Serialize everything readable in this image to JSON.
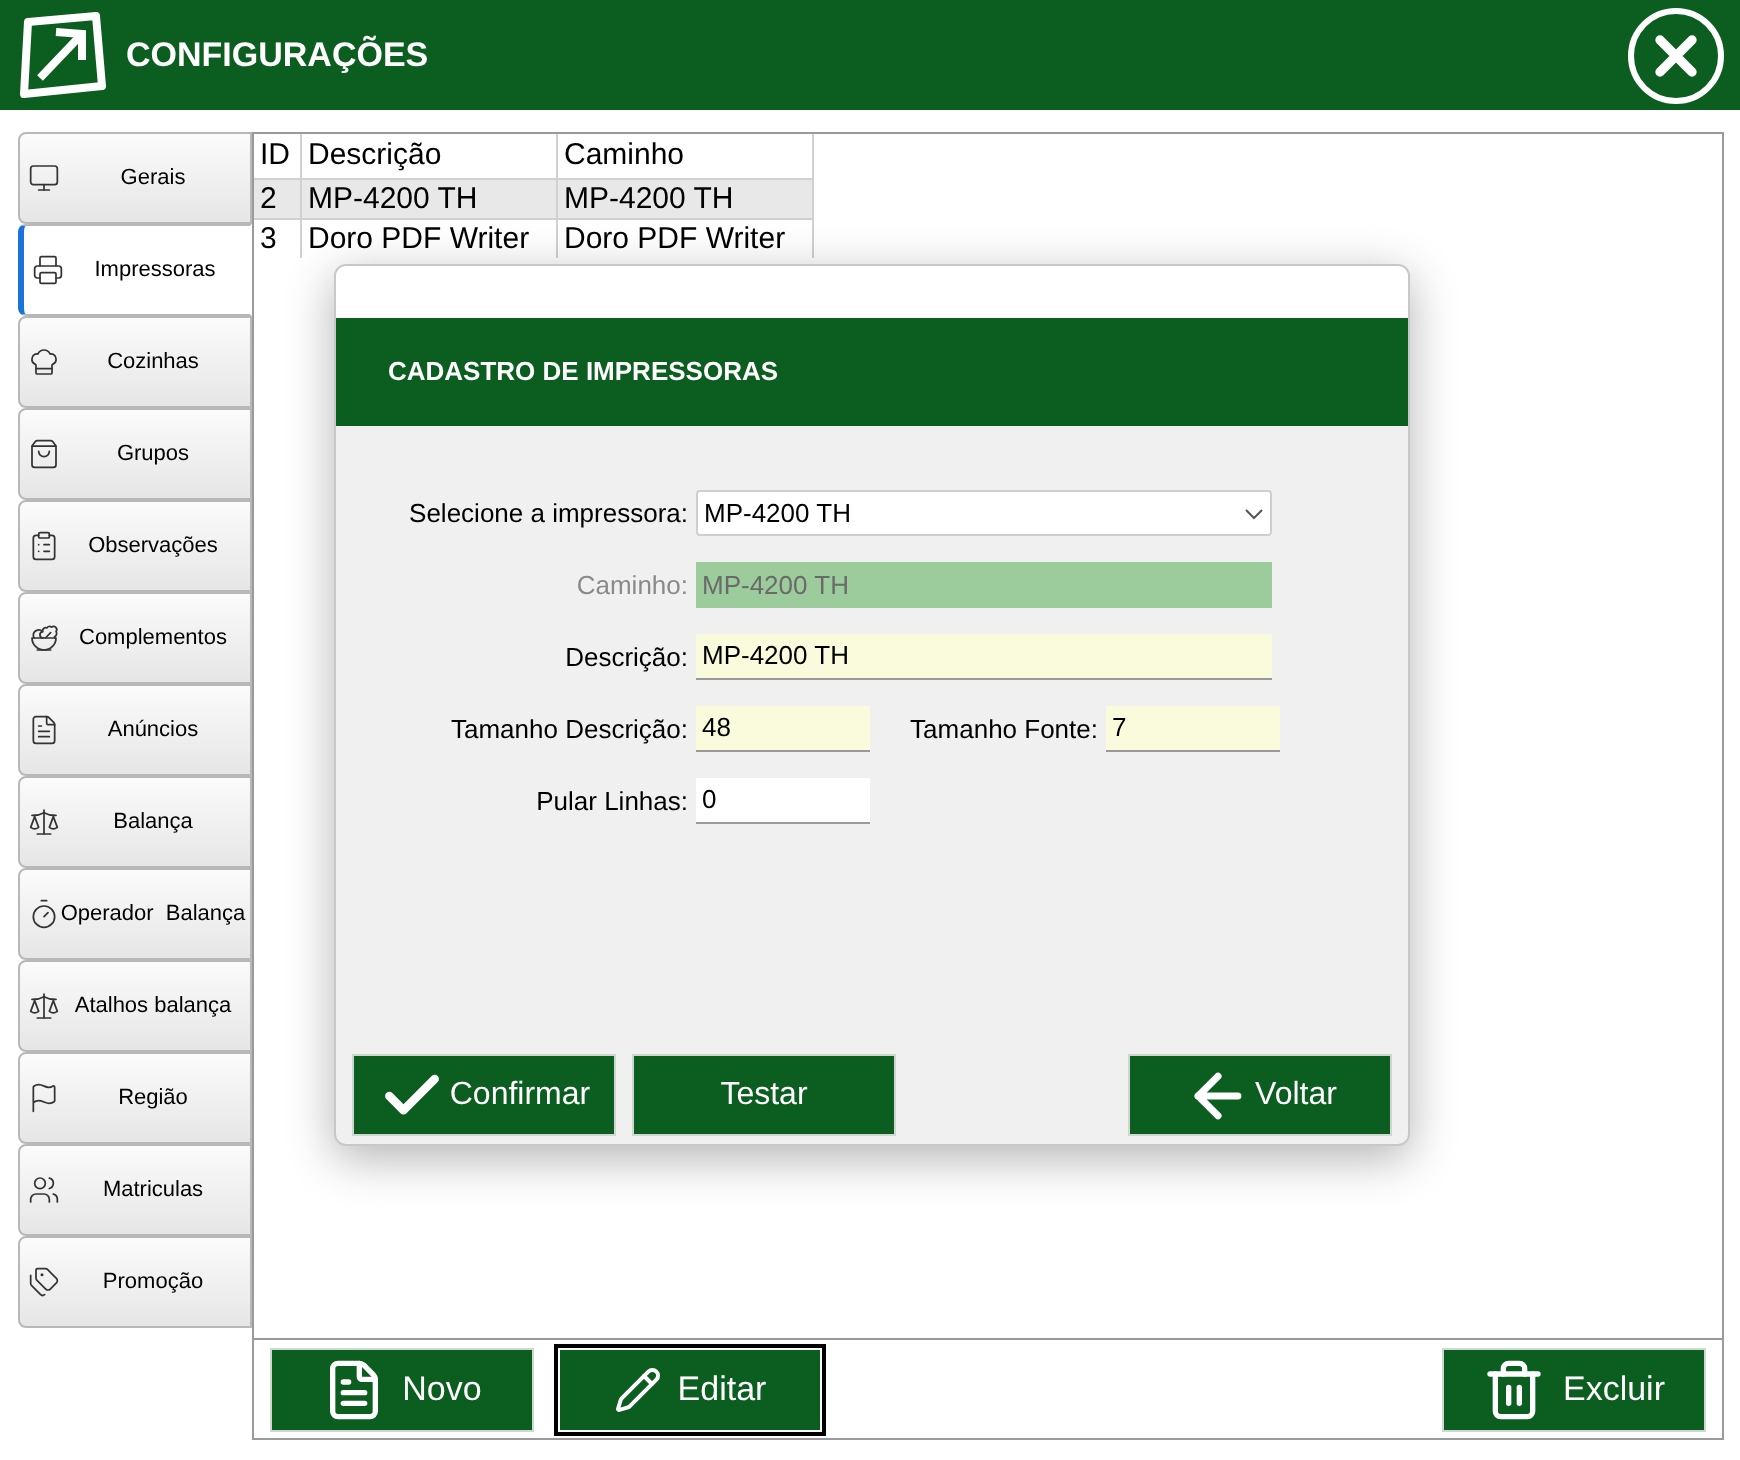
{
  "window": {
    "title": "CONFIGURAÇÕES"
  },
  "sidebar": {
    "items": [
      {
        "label": "Gerais",
        "selected": false
      },
      {
        "label": "Impressoras",
        "selected": true
      },
      {
        "label": "Cozinhas",
        "selected": false
      },
      {
        "label": "Grupos",
        "selected": false
      },
      {
        "label": "Observações",
        "selected": false
      },
      {
        "label": "Complementos",
        "selected": false
      },
      {
        "label": "Anúncios",
        "selected": false
      },
      {
        "label": "Balança",
        "selected": false
      },
      {
        "label": "Operador  Balança",
        "selected": false
      },
      {
        "label": "Atalhos balança",
        "selected": false
      },
      {
        "label": "Região",
        "selected": false
      },
      {
        "label": "Matriculas",
        "selected": false
      },
      {
        "label": "Promoção",
        "selected": false
      }
    ]
  },
  "table": {
    "columns": [
      "ID",
      "Descrição",
      "Caminho"
    ],
    "rows": [
      {
        "cells": [
          "2",
          "MP-4200 TH",
          "MP-4200 TH"
        ],
        "selected": true
      },
      {
        "cells": [
          "3",
          "Doro PDF Writer",
          "Doro PDF Writer"
        ],
        "selected": false
      }
    ]
  },
  "dialog": {
    "title": "CADASTRO DE IMPRESSORAS",
    "printer_select": {
      "label": "Selecione a impressora:",
      "value": "MP-4200 TH"
    },
    "path": {
      "label": "Caminho:",
      "value": "MP-4200 TH",
      "disabled": true
    },
    "description": {
      "label": "Descrição:",
      "value": "MP-4200 TH"
    },
    "description_size": {
      "label": "Tamanho Descrição:",
      "value": "48"
    },
    "font_size": {
      "label": "Tamanho Fonte:",
      "value": "7"
    },
    "skip_lines": {
      "label": "Pular Linhas:",
      "value": "0"
    },
    "buttons": [
      {
        "label": "Confirmar",
        "kind": "confirm"
      },
      {
        "label": "Testar",
        "kind": "test"
      },
      {
        "label": "Voltar",
        "kind": "back"
      }
    ]
  },
  "actions": [
    {
      "label": "Novo",
      "kind": "new",
      "selected": false
    },
    {
      "label": "Editar",
      "kind": "edit",
      "selected": true
    },
    {
      "label": "Excluir",
      "kind": "delete",
      "selected": false
    }
  ]
}
